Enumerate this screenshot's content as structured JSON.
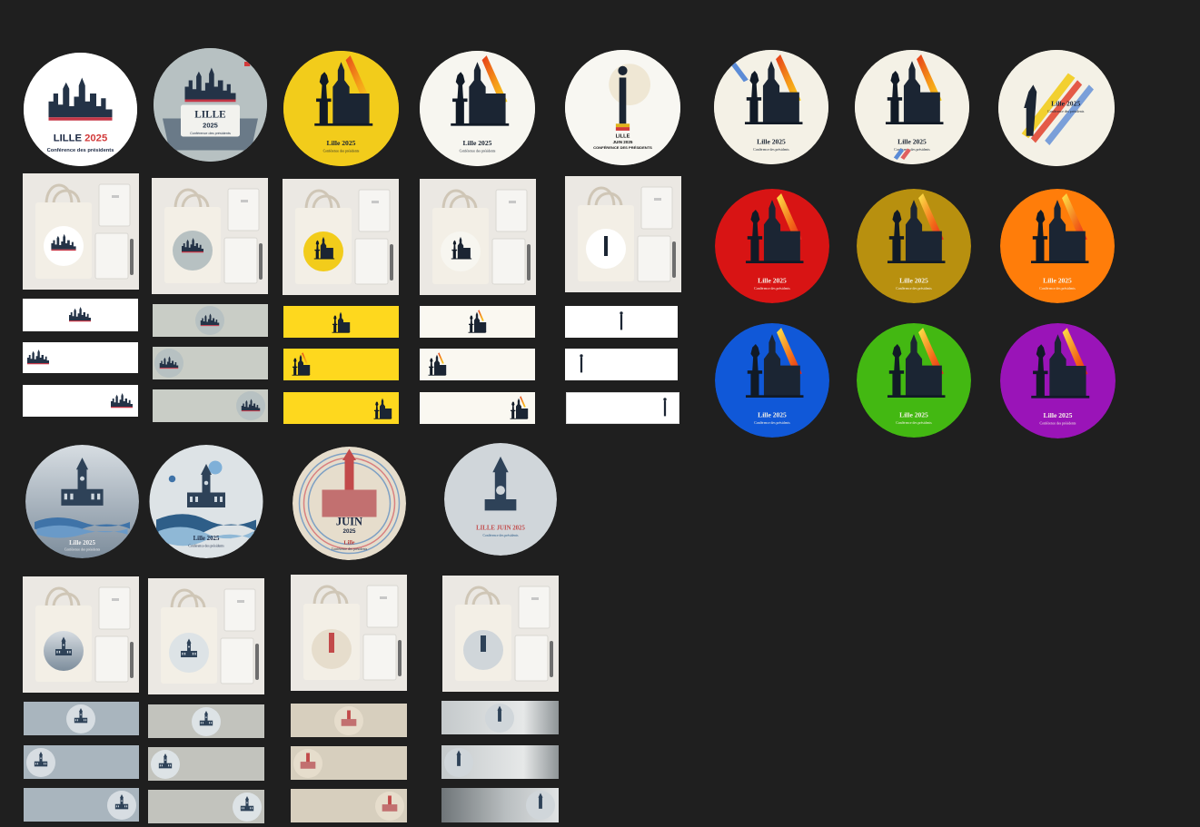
{
  "canvas": {
    "background": "#1f1f1f"
  },
  "row1_logos": [
    {
      "id": "collage-stamp",
      "line1": "LILLE",
      "line1_accent": "2025",
      "line2": "Conférence des présidents"
    },
    {
      "id": "architecture-badge",
      "line1": "LILLE",
      "line2": "2025",
      "line3": "Conférence des présidents"
    },
    {
      "id": "yellow-silhouette",
      "line1": "Lille 2025",
      "line2": "Conférence des présidents",
      "bg": "#f2cc1b"
    },
    {
      "id": "white-silhouette",
      "line1": "Lille 2025",
      "line2": "Conférence des présidents",
      "bg": "#f7f6f0"
    },
    {
      "id": "column-monument",
      "line1": "LILLE",
      "line2": "JUIN 2025",
      "line3": "CONFÉRENCE DES PRÉSIDENTS",
      "bg": "#f8f7f2"
    },
    {
      "id": "cream-flag-silhouette",
      "line1": "Lille 2025",
      "line2": "Conférence des présidents",
      "bg": "#f4f1e6"
    },
    {
      "id": "cream-flag-silhouette-2",
      "line1": "Lille 2025",
      "line2": "Conférence des présidents",
      "bg": "#f4f1e6"
    },
    {
      "id": "statue-stripes",
      "line1": "Lille 2025",
      "line2": "Conférence des présidents",
      "bg": "#f4f1e6"
    }
  ],
  "color_variants": [
    {
      "line1": "Lille 2025",
      "line2": "Conférence des présidents",
      "bg": "#d81414"
    },
    {
      "line1": "Lille 2025",
      "line2": "Conférence des présidents",
      "bg": "#b8900f"
    },
    {
      "line1": "Lille 2025",
      "line2": "Conférence des présidents",
      "bg": "#ff7d0a"
    },
    {
      "line1": "Lille 2025",
      "line2": "Conférence des présidents",
      "bg": "#1058d8"
    },
    {
      "line1": "Lille 2025",
      "line2": "Conférence des présidents",
      "bg": "#43b812"
    },
    {
      "line1": "Lille 2025",
      "line2": "Conférence des présidents",
      "bg": "#9a14b8"
    }
  ],
  "row2_logos": [
    {
      "id": "belfry-waves",
      "line1": "Lille 2025",
      "line2": "Conférence des présidents"
    },
    {
      "id": "cityscape-waves",
      "line1": "Lille 2025",
      "line2": "Conférence des présidents"
    },
    {
      "id": "juin-stripes",
      "line1": "JUIN",
      "line2": "2025",
      "line3": "Lille",
      "line4": "Conférence des présidents"
    },
    {
      "id": "minimal-belfry",
      "line1": "LILLE JUIN 2025",
      "line2": "Conférence des présidents"
    }
  ],
  "banner_sets": {
    "row1": [
      {
        "color": "#ffffff"
      },
      {
        "color": "#c9cdc6"
      },
      {
        "color": "#fed81e"
      },
      {
        "color": "#faf8f1"
      },
      {
        "color": "#ffffff"
      }
    ],
    "row2": [
      {
        "color": "#a9b5be"
      },
      {
        "color": "#c2c3bd"
      },
      {
        "color": "#d7cfbe"
      },
      {
        "color": "#c4c9cb"
      }
    ]
  }
}
